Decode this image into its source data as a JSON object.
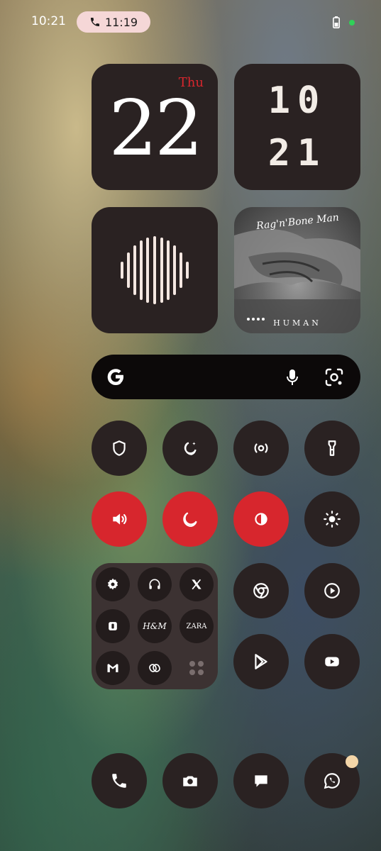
{
  "status_bar": {
    "time": "10:21",
    "call_duration": "11:19"
  },
  "date_widget": {
    "day": "Thu",
    "date": "22"
  },
  "clock_widget": {
    "hour": "10",
    "minute": "21"
  },
  "album_widget": {
    "artist": "Rag'n'Bone Man",
    "title": "HUMAN"
  },
  "search_bar": {
    "icons": [
      "google-logo",
      "mic-icon",
      "lens-icon"
    ]
  },
  "quick_toggles": [
    {
      "name": "shield",
      "active": false
    },
    {
      "name": "bedtime",
      "active": false
    },
    {
      "name": "hotspot",
      "active": false
    },
    {
      "name": "flashlight",
      "active": false
    },
    {
      "name": "sound",
      "active": true
    },
    {
      "name": "dark-mode",
      "active": true
    },
    {
      "name": "contrast",
      "active": true
    },
    {
      "name": "brightness",
      "active": false
    }
  ],
  "app_folder": {
    "apps": [
      "settings",
      "headphones",
      "x",
      "app",
      "H&M",
      "ZARA",
      "gmail",
      "bondee",
      "more"
    ],
    "hm_label": "H&M",
    "zara_label": "ZARA"
  },
  "apps": [
    "chrome",
    "music-player",
    "play-store",
    "youtube"
  ],
  "dock": [
    "phone",
    "camera",
    "messages",
    "whatsapp"
  ],
  "colors": {
    "accent_red": "#d7262d",
    "tile_bg": "#2a2222",
    "call_pill_bg": "#f5d7d7"
  }
}
